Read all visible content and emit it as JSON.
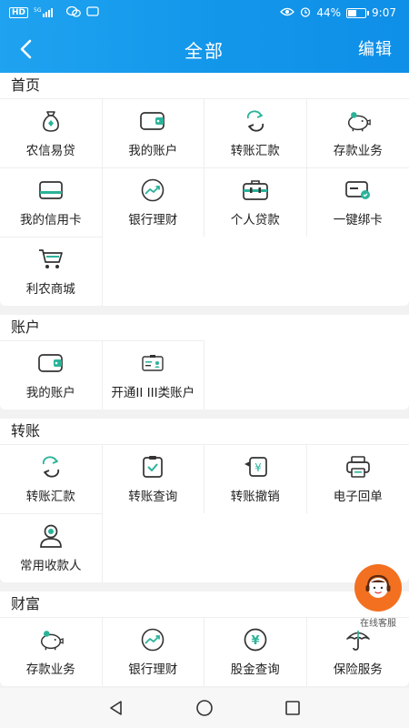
{
  "status_bar": {
    "network": "HD",
    "signal": "5G",
    "battery": "44%",
    "time": "9:07"
  },
  "header": {
    "title": "全部",
    "edit_label": "编辑"
  },
  "sections": [
    {
      "title": "首页",
      "items": [
        {
          "label": "农信易贷",
          "icon": "money-bag-icon"
        },
        {
          "label": "我的账户",
          "icon": "wallet-icon"
        },
        {
          "label": "转账汇款",
          "icon": "transfer-icon"
        },
        {
          "label": "存款业务",
          "icon": "piggy-bank-icon"
        },
        {
          "label": "我的信用卡",
          "icon": "credit-card-icon"
        },
        {
          "label": "银行理财",
          "icon": "finance-chart-icon"
        },
        {
          "label": "个人贷款",
          "icon": "briefcase-icon"
        },
        {
          "label": "一键绑卡",
          "icon": "bind-card-icon"
        },
        {
          "label": "利农商城",
          "icon": "shopping-cart-icon"
        }
      ]
    },
    {
      "title": "账户",
      "items": [
        {
          "label": "我的账户",
          "icon": "wallet-icon"
        },
        {
          "label": "开通II III类账户",
          "icon": "id-card-icon"
        }
      ]
    },
    {
      "title": "转账",
      "items": [
        {
          "label": "转账汇款",
          "icon": "transfer-icon"
        },
        {
          "label": "转账查询",
          "icon": "clipboard-check-icon"
        },
        {
          "label": "转账撤销",
          "icon": "undo-yuan-icon"
        },
        {
          "label": "电子回单",
          "icon": "printer-icon"
        },
        {
          "label": "常用收款人",
          "icon": "payee-icon"
        }
      ]
    },
    {
      "title": "财富",
      "items": [
        {
          "label": "存款业务",
          "icon": "piggy-bank-icon"
        },
        {
          "label": "银行理财",
          "icon": "finance-chart-icon"
        },
        {
          "label": "股金查询",
          "icon": "yuan-coin-icon"
        },
        {
          "label": "保险服务",
          "icon": "umbrella-icon"
        }
      ]
    }
  ],
  "online_service": {
    "label": "在线客服"
  }
}
